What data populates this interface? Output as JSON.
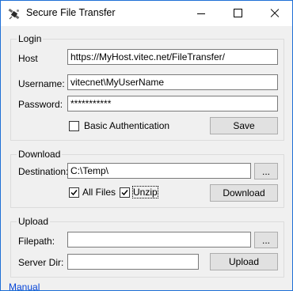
{
  "window": {
    "title": "Secure File Transfer",
    "app_icon": "satellite-icon"
  },
  "login": {
    "legend": "Login",
    "host_label": "Host",
    "host_value": "https://MyHost.vitec.net/FileTransfer/",
    "username_label": "Username:",
    "username_value": "vitecnet\\MyUserName",
    "password_label": "Password:",
    "password_value": "***********",
    "basic_auth_label": "Basic Authentication",
    "basic_auth_checked": false,
    "save_label": "Save"
  },
  "download": {
    "legend": "Download",
    "destination_label": "Destination:",
    "destination_value": "C:\\Temp\\",
    "browse_label": "...",
    "all_files_label": "All Files",
    "all_files_checked": true,
    "unzip_label": "Unzip",
    "unzip_checked": true,
    "download_label": "Download"
  },
  "upload": {
    "legend": "Upload",
    "filepath_label": "Filepath:",
    "filepath_value": "",
    "browse_label": "...",
    "server_dir_label": "Server Dir:",
    "server_dir_value": "",
    "upload_label": "Upload"
  },
  "footer": {
    "manual_link": "Manual"
  }
}
